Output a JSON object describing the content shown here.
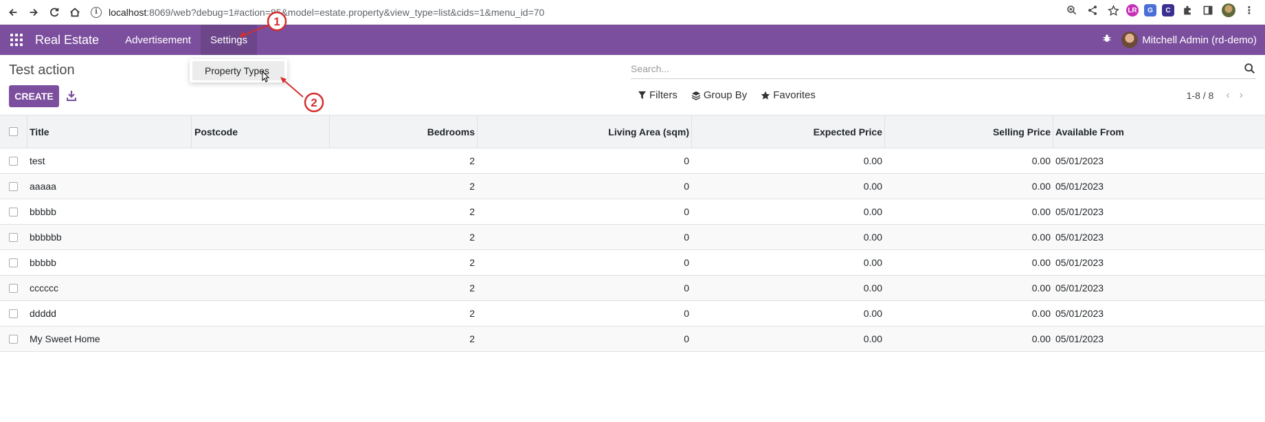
{
  "browser": {
    "url_host": "localhost",
    "url_rest": ":8069/web?debug=1#action=85&model=estate.property&view_type=list&cids=1&menu_id=70"
  },
  "navbar": {
    "brand": "Real Estate",
    "menu": [
      {
        "label": "Advertisement"
      },
      {
        "label": "Settings"
      }
    ],
    "user": "Mitchell Admin (rd-demo)"
  },
  "dropdown": {
    "item": "Property Types"
  },
  "control_panel": {
    "title": "Test action",
    "create_label": "CREATE",
    "search_placeholder": "Search...",
    "filters_label": "Filters",
    "groupby_label": "Group By",
    "favorites_label": "Favorites",
    "pager": "1-8 / 8"
  },
  "table": {
    "headers": [
      "Title",
      "Postcode",
      "Bedrooms",
      "Living Area (sqm)",
      "Expected Price",
      "Selling Price",
      "Available From"
    ],
    "rows": [
      {
        "title": "test",
        "postcode": "",
        "bedrooms": "2",
        "living_area": "0",
        "expected_price": "0.00",
        "selling_price": "0.00",
        "available_from": "05/01/2023"
      },
      {
        "title": "aaaaa",
        "postcode": "",
        "bedrooms": "2",
        "living_area": "0",
        "expected_price": "0.00",
        "selling_price": "0.00",
        "available_from": "05/01/2023"
      },
      {
        "title": "bbbbb",
        "postcode": "",
        "bedrooms": "2",
        "living_area": "0",
        "expected_price": "0.00",
        "selling_price": "0.00",
        "available_from": "05/01/2023"
      },
      {
        "title": "bbbbbb",
        "postcode": "",
        "bedrooms": "2",
        "living_area": "0",
        "expected_price": "0.00",
        "selling_price": "0.00",
        "available_from": "05/01/2023"
      },
      {
        "title": "bbbbb",
        "postcode": "",
        "bedrooms": "2",
        "living_area": "0",
        "expected_price": "0.00",
        "selling_price": "0.00",
        "available_from": "05/01/2023"
      },
      {
        "title": "cccccc",
        "postcode": "",
        "bedrooms": "2",
        "living_area": "0",
        "expected_price": "0.00",
        "selling_price": "0.00",
        "available_from": "05/01/2023"
      },
      {
        "title": "ddddd",
        "postcode": "",
        "bedrooms": "2",
        "living_area": "0",
        "expected_price": "0.00",
        "selling_price": "0.00",
        "available_from": "05/01/2023"
      },
      {
        "title": "My Sweet Home",
        "postcode": "",
        "bedrooms": "2",
        "living_area": "0",
        "expected_price": "0.00",
        "selling_price": "0.00",
        "available_from": "05/01/2023"
      }
    ]
  },
  "annotations": [
    "1",
    "2"
  ],
  "colors": {
    "brand": "#7c4f9e",
    "arrow": "#d32f2f"
  }
}
